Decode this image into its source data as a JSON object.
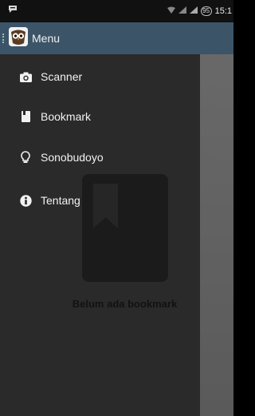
{
  "status_bar": {
    "time": "15:1",
    "battery": "95",
    "icons": [
      "chat-notification-icon",
      "wifi-icon",
      "signal-icon",
      "signal-icon",
      "battery-icon"
    ]
  },
  "action_bar": {
    "title": "Menu",
    "logo_icon": "owl-logo-icon",
    "color": "#3c5468"
  },
  "drawer": {
    "items": [
      {
        "label": "Scanner",
        "icon": "camera-icon"
      },
      {
        "label": "Bookmark",
        "icon": "book-icon"
      },
      {
        "label": "Sonobudoyo",
        "icon": "lightbulb-icon"
      },
      {
        "label": "Tentang",
        "icon": "info-icon"
      }
    ]
  },
  "empty_state": {
    "text": "Belum ada bookmark",
    "icon": "bookmark-icon"
  }
}
